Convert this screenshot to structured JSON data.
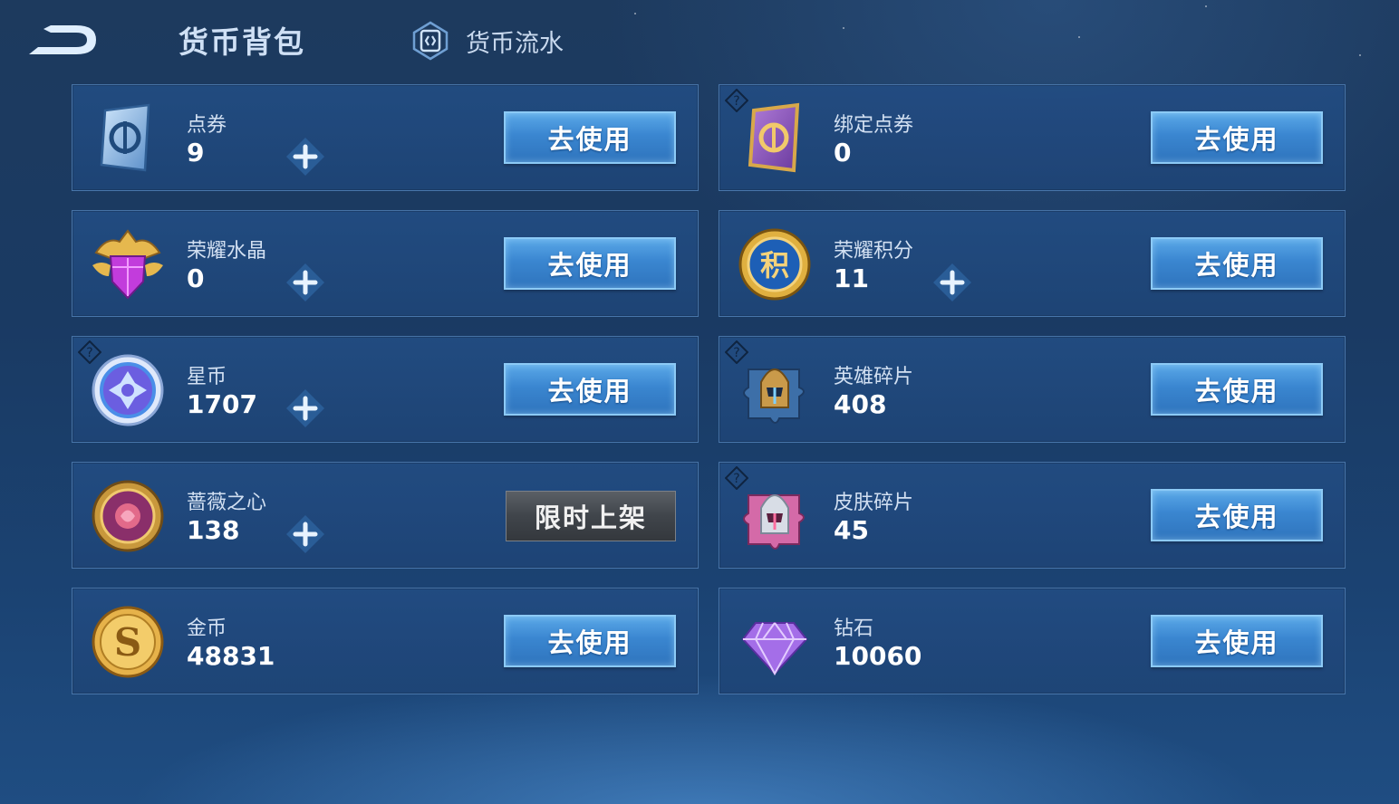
{
  "header": {
    "title": "货币背包",
    "flow_tab_label": "货币流水"
  },
  "cards": [
    {
      "name": "点券",
      "amount": "9",
      "button": "去使用",
      "icon": "coupon-icon",
      "has_plus": true,
      "has_help": false
    },
    {
      "name": "绑定点券",
      "amount": "0",
      "button": "去使用",
      "icon": "bound-coupon-icon",
      "has_plus": false,
      "has_help": true
    },
    {
      "name": "荣耀水晶",
      "amount": "0",
      "button": "去使用",
      "icon": "glory-crystal-icon",
      "has_plus": true,
      "has_help": false
    },
    {
      "name": "荣耀积分",
      "amount": "11",
      "button": "去使用",
      "icon": "glory-points-icon",
      "has_plus": true,
      "has_help": false
    },
    {
      "name": "星币",
      "amount": "1707",
      "button": "去使用",
      "icon": "star-coin-icon",
      "has_plus": true,
      "has_help": true
    },
    {
      "name": "英雄碎片",
      "amount": "408",
      "button": "去使用",
      "icon": "hero-shard-icon",
      "has_plus": false,
      "has_help": true
    },
    {
      "name": "蔷薇之心",
      "amount": "138",
      "button": "限时上架",
      "icon": "rose-heart-icon",
      "has_plus": true,
      "has_help": false
    },
    {
      "name": "皮肤碎片",
      "amount": "45",
      "button": "去使用",
      "icon": "skin-shard-icon",
      "has_plus": false,
      "has_help": true
    },
    {
      "name": "金币",
      "amount": "48831",
      "button": "去使用",
      "icon": "gold-coin-icon",
      "has_plus": false,
      "has_help": false
    },
    {
      "name": "钻石",
      "amount": "10060",
      "button": "去使用",
      "icon": "diamond-icon",
      "has_plus": false,
      "has_help": false
    }
  ],
  "colors": {
    "button_blue": "#3a86d0",
    "button_border": "#8ccaf6",
    "limited_button_gray": "#40454b",
    "card_bg": "#224c82"
  }
}
